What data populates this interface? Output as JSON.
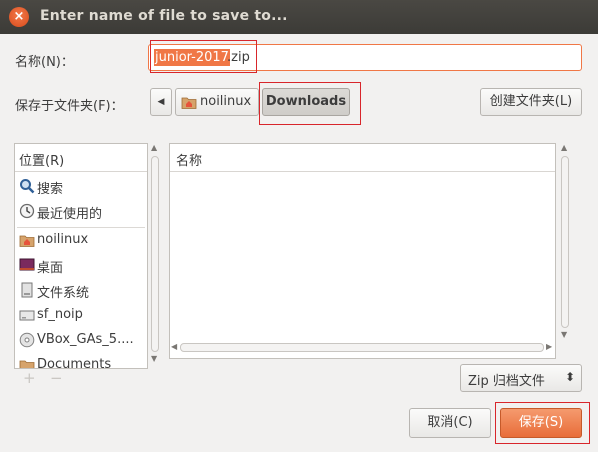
{
  "window": {
    "title": "Enter name of file to save to...",
    "close_glyph": "×"
  },
  "name_row": {
    "label": "名称(N)：",
    "selected_text": "junior-2017",
    "rest_text": ".zip"
  },
  "folder_row": {
    "label": "保存于文件夹(F)：",
    "back_glyph": "◀",
    "crumbs": [
      {
        "label": "noilinux",
        "icon": "home-folder-icon"
      },
      {
        "label": "Downloads"
      }
    ],
    "create_folder_label": "创建文件夹(L)"
  },
  "places": {
    "header": "位置(R)",
    "items": [
      {
        "label": "搜索",
        "icon": "search-icon"
      },
      {
        "label": "最近使用的",
        "icon": "recent-clock-icon"
      },
      {
        "label": "noilinux",
        "icon": "home-folder-icon"
      },
      {
        "label": "桌面",
        "icon": "desktop-icon"
      },
      {
        "label": "文件系统",
        "icon": "drive-icon"
      },
      {
        "label": "sf_noip",
        "icon": "drive-icon"
      },
      {
        "label": "VBox_GAs_5....",
        "icon": "optical-disc-icon"
      },
      {
        "label": "Documents",
        "icon": "folder-icon"
      }
    ],
    "add_glyph": "+",
    "remove_glyph": "−"
  },
  "files": {
    "column_header": "名称",
    "rows": []
  },
  "filter": {
    "label": "Zip 归档文件",
    "glyph": "⬍"
  },
  "buttons": {
    "cancel": "取消(C)",
    "save": "保存(S)"
  },
  "colors": {
    "accent": "#f07746",
    "highlight_box": "#d8262b",
    "titlebar": "#3c3b37"
  }
}
